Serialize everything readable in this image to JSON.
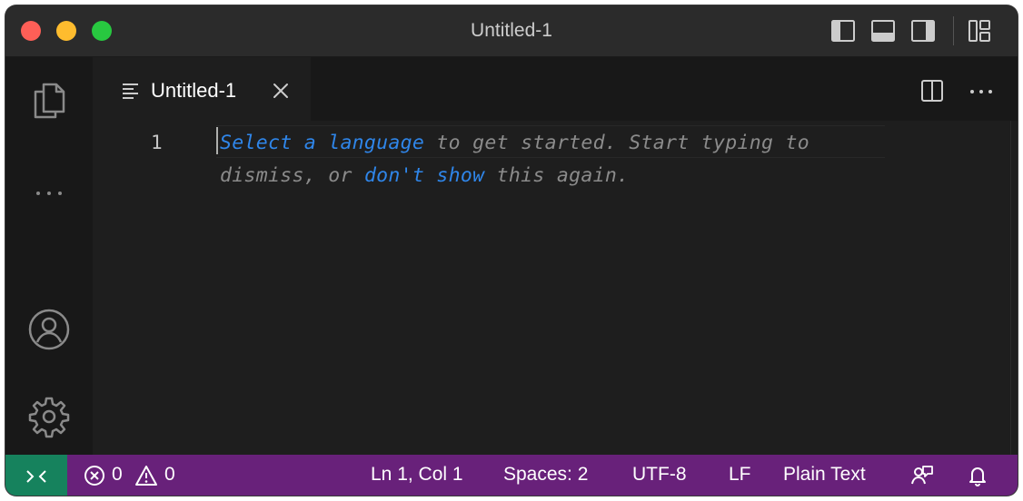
{
  "window": {
    "title": "Untitled-1"
  },
  "tab": {
    "label": "Untitled-1"
  },
  "editor": {
    "line_number": "1",
    "hint": {
      "part1": "Select a language",
      "part2": " to get started. Start typing to ",
      "part3": "dismiss, or ",
      "part4": "don't show",
      "part5": " this again."
    }
  },
  "status": {
    "errors": "0",
    "warnings": "0",
    "position": "Ln 1, Col 1",
    "spaces": "Spaces: 2",
    "encoding": "UTF-8",
    "eol": "LF",
    "language": "Plain Text"
  },
  "colors": {
    "statusbar": "#68217a",
    "remote": "#16825d",
    "link": "#2f86ea"
  }
}
